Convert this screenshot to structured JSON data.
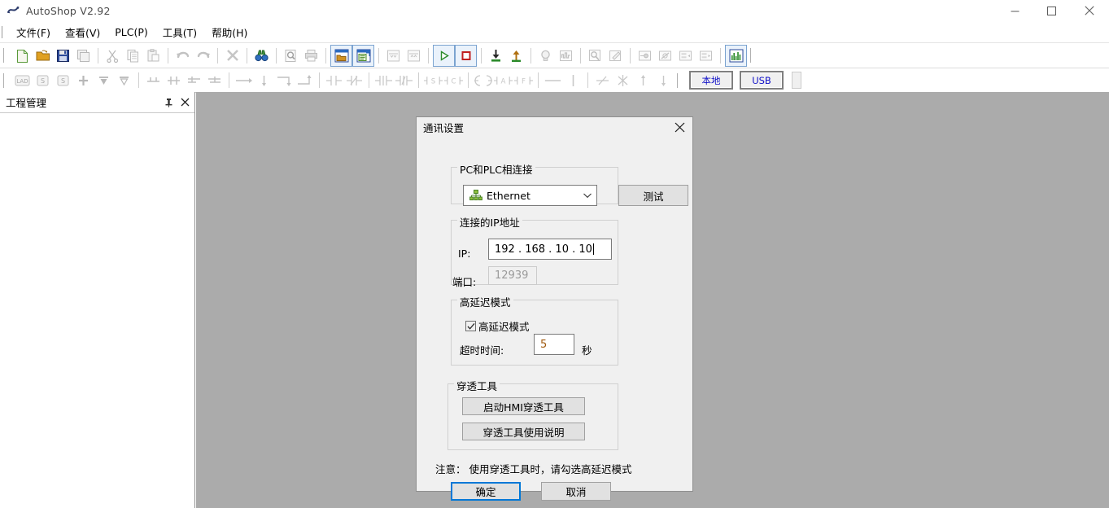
{
  "window": {
    "title": "AutoShop V2.92",
    "app_icon": "autoshop-logo-icon",
    "minimize_label": "—",
    "maximize_label": "☐",
    "close_label": "✕"
  },
  "menu": {
    "items": [
      {
        "label": "文件(F)",
        "name": "menu-file"
      },
      {
        "label": "查看(V)",
        "name": "menu-view"
      },
      {
        "label": "PLC(P)",
        "name": "menu-plc"
      },
      {
        "label": "工具(T)",
        "name": "menu-tools"
      },
      {
        "label": "帮助(H)",
        "name": "menu-help"
      }
    ]
  },
  "toolbar_main": {
    "groups": [
      [
        "new-file-icon",
        "open-folder-icon",
        "save-icon",
        "save-all-icon"
      ],
      [
        "cut-icon",
        "copy-icon",
        "paste-icon"
      ],
      [
        "undo-icon",
        "redo-icon"
      ],
      [
        "delete-x-icon"
      ],
      [
        "find-binoculars-icon"
      ],
      [
        "print-preview-icon",
        "print-icon"
      ],
      [
        "project-window-icon",
        "instruction-window-icon"
      ],
      [
        "compress-rows-icon",
        "expand-rows-icon"
      ],
      [
        "run-icon",
        "stop-icon"
      ],
      [
        "download-plc-icon",
        "upload-plc-icon"
      ],
      [
        "monitor-lamp-icon",
        "waveform-icon"
      ],
      [
        "cross-reference-icon",
        "edit-comment-icon"
      ],
      [
        "element-monitor-icon",
        "element-clear-icon"
      ],
      [
        "insert-row-icon",
        "delete-row-icon"
      ],
      [
        "chart-trend-icon"
      ]
    ]
  },
  "toolbar_ladder": {
    "groups": [
      [
        "lad-mode-icon",
        "st-mode-icon",
        "sfc-mode-icon"
      ],
      [
        "insert-vertical-icon",
        "insert-down-icon",
        "delete-down-icon"
      ],
      [
        "branch-up-icon",
        "branch-down-icon",
        "branch-left-icon",
        "branch-right-icon"
      ],
      [
        "line-right-icon",
        "line-down-icon",
        "corner-icon",
        "corner2-icon"
      ],
      [
        "contact-no-icon",
        "contact-nc-icon"
      ],
      [
        "rising-edge-icon",
        "falling-edge-icon"
      ],
      [
        "set-coil-icon",
        "reset-coil-icon"
      ],
      [
        "coil-icon",
        "coil-a-icon",
        "coil-f-icon"
      ],
      [
        "hline-icon",
        "vline-icon"
      ],
      [
        "diagonal-del-icon",
        "cross-del-icon",
        "arrow-up-icon",
        "arrow-down-icon"
      ]
    ],
    "mode_local": "本地",
    "mode_usb": "USB"
  },
  "left_panel": {
    "title": "工程管理",
    "pin_icon": "pin-icon",
    "close_icon": "close-icon"
  },
  "dialog": {
    "title": "通讯设置",
    "close_icon": "close-icon",
    "group_connection": {
      "legend": "PC和PLC相连接",
      "combo_value": "Ethernet",
      "combo_icon": "ethernet-network-icon",
      "test_button": "测试"
    },
    "group_ip": {
      "legend": "连接的IP地址",
      "ip_label": "IP:",
      "ip_value": "192 . 168 . 10  . 10",
      "port_label": "端口:",
      "port_value": "12939"
    },
    "group_latency": {
      "legend": "高延迟模式",
      "checkbox_label": "高延迟模式",
      "checkbox_checked": true,
      "timeout_label": "超时时间:",
      "timeout_value": "5",
      "timeout_unit": "秒"
    },
    "group_passthrough": {
      "legend": "穿透工具",
      "start_button": "启动HMI穿透工具",
      "help_button": "穿透工具使用说明"
    },
    "note": "注意： 使用穿透工具时，请勾选高延迟模式",
    "ok_button": "确定",
    "cancel_button": "取消"
  },
  "colors": {
    "workspace_bg": "#ababab",
    "dialog_bg": "#f0f0f0",
    "accent_focus": "#0078d7",
    "mode_text": "#1010c8",
    "disabled_text": "#9a9a9a"
  }
}
